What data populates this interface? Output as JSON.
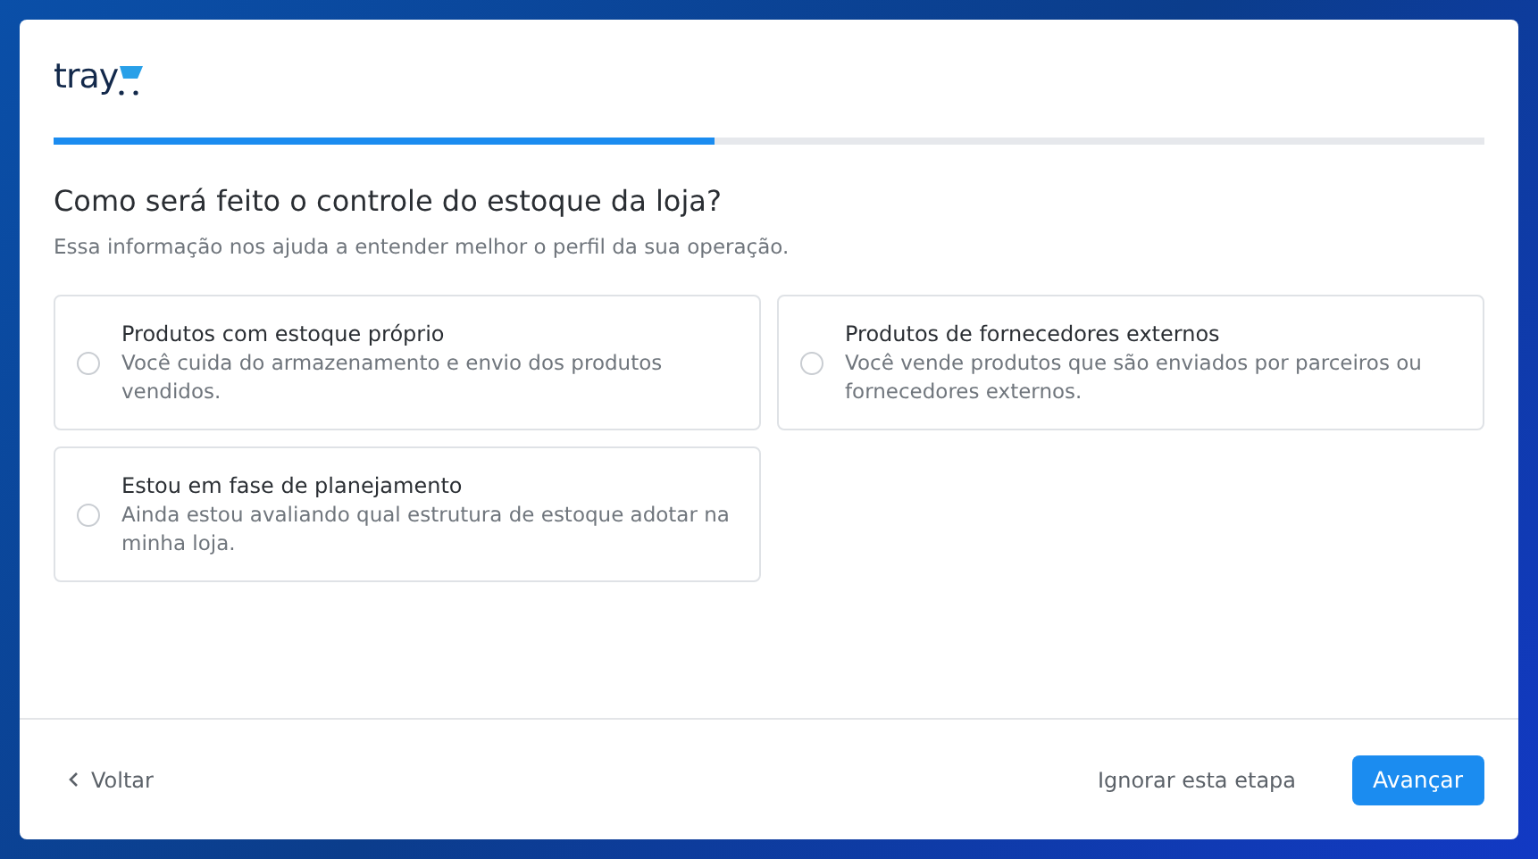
{
  "logo": {
    "text": "tray"
  },
  "progress": {
    "level": 0.462
  },
  "question": {
    "title": "Como será feito o controle do estoque da loja?",
    "subtitle": "Essa informação nos ajuda a entender melhor o perfil da sua operação."
  },
  "options": [
    {
      "title": "Produtos com estoque próprio",
      "description": "Você cuida do armazenamento e envio dos produtos vendidos.",
      "selected": false
    },
    {
      "title": "Produtos de fornecedores externos",
      "description": "Você vende produtos que são enviados por parceiros ou fornecedores externos.",
      "selected": false
    },
    {
      "title": "Estou em fase de planejamento",
      "description": "Ainda estou avaliando qual estrutura de estoque adotar na minha loja.",
      "selected": false
    }
  ],
  "footer": {
    "back": "Voltar",
    "skip": "Ignorar esta etapa",
    "next": "Avançar"
  }
}
